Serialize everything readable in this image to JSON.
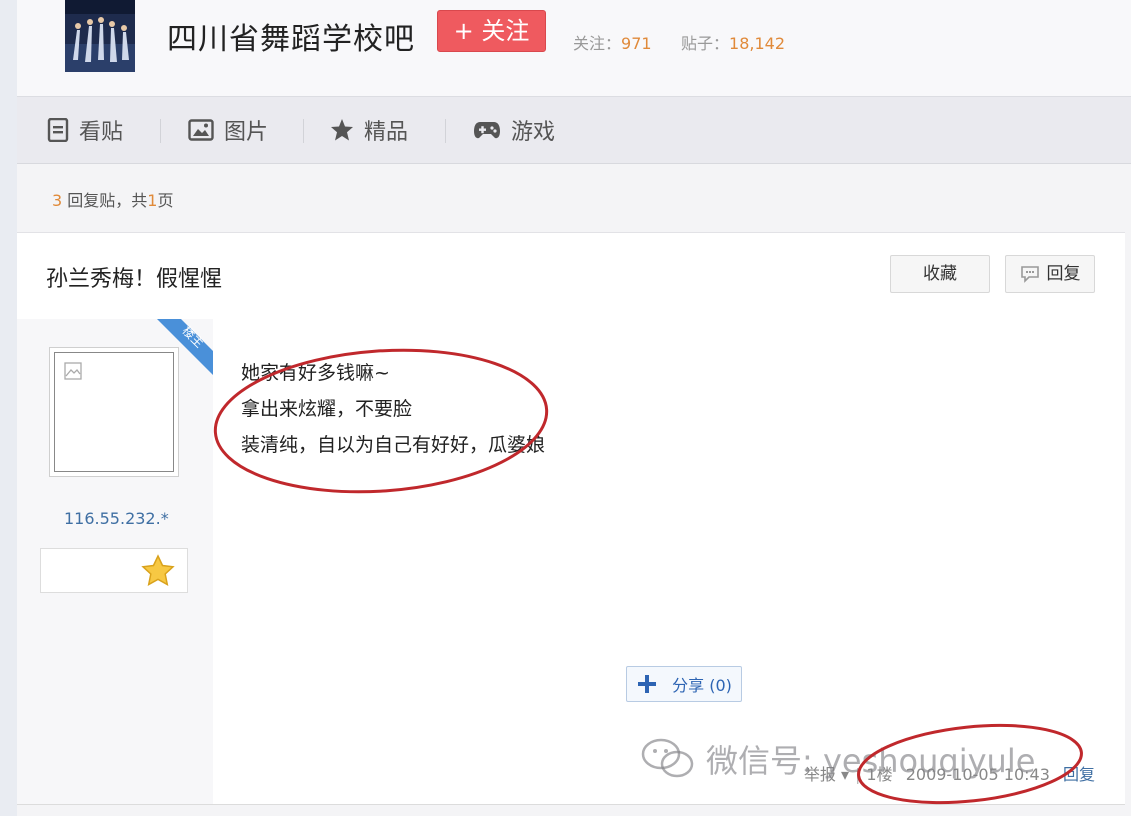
{
  "forum": {
    "title": "四川省舞蹈学校吧",
    "follow_label": "+ 关注",
    "followers_label": "关注：",
    "followers_value": "971",
    "posts_label": "贴子：",
    "posts_value": "18,142"
  },
  "nav": {
    "items": [
      {
        "label": "看贴",
        "icon": "document-icon"
      },
      {
        "label": "图片",
        "icon": "image-icon"
      },
      {
        "label": "精品",
        "icon": "star-icon"
      },
      {
        "label": "游戏",
        "icon": "gamepad-icon"
      }
    ]
  },
  "pager": {
    "reply_count": "3",
    "reply_text": " 回复贴，共",
    "page_count": "1",
    "page_suffix": "页"
  },
  "thread": {
    "title": "孙兰秀梅！假惺惺",
    "favorite_label": "收藏",
    "reply_label": "回复"
  },
  "post": {
    "badge": "楼主",
    "author_ip": "116.55.232.*",
    "lines": [
      "她家有好多钱嘛~",
      "拿出来炫耀，不要脸",
      "装清纯，自以为自己有好好，瓜婆娘"
    ],
    "share_label": "分享 (0)",
    "report_label": "举报",
    "floor": "1楼",
    "timestamp": "2009-10-05 10:43",
    "reply_label": "回复"
  },
  "watermark": {
    "text": "微信号: yeshouqiyule"
  },
  "colors": {
    "follow": "#ef5a5f",
    "accent_number": "#e08a3a",
    "link": "#3f6fa3",
    "annotation": "#c0282c"
  }
}
